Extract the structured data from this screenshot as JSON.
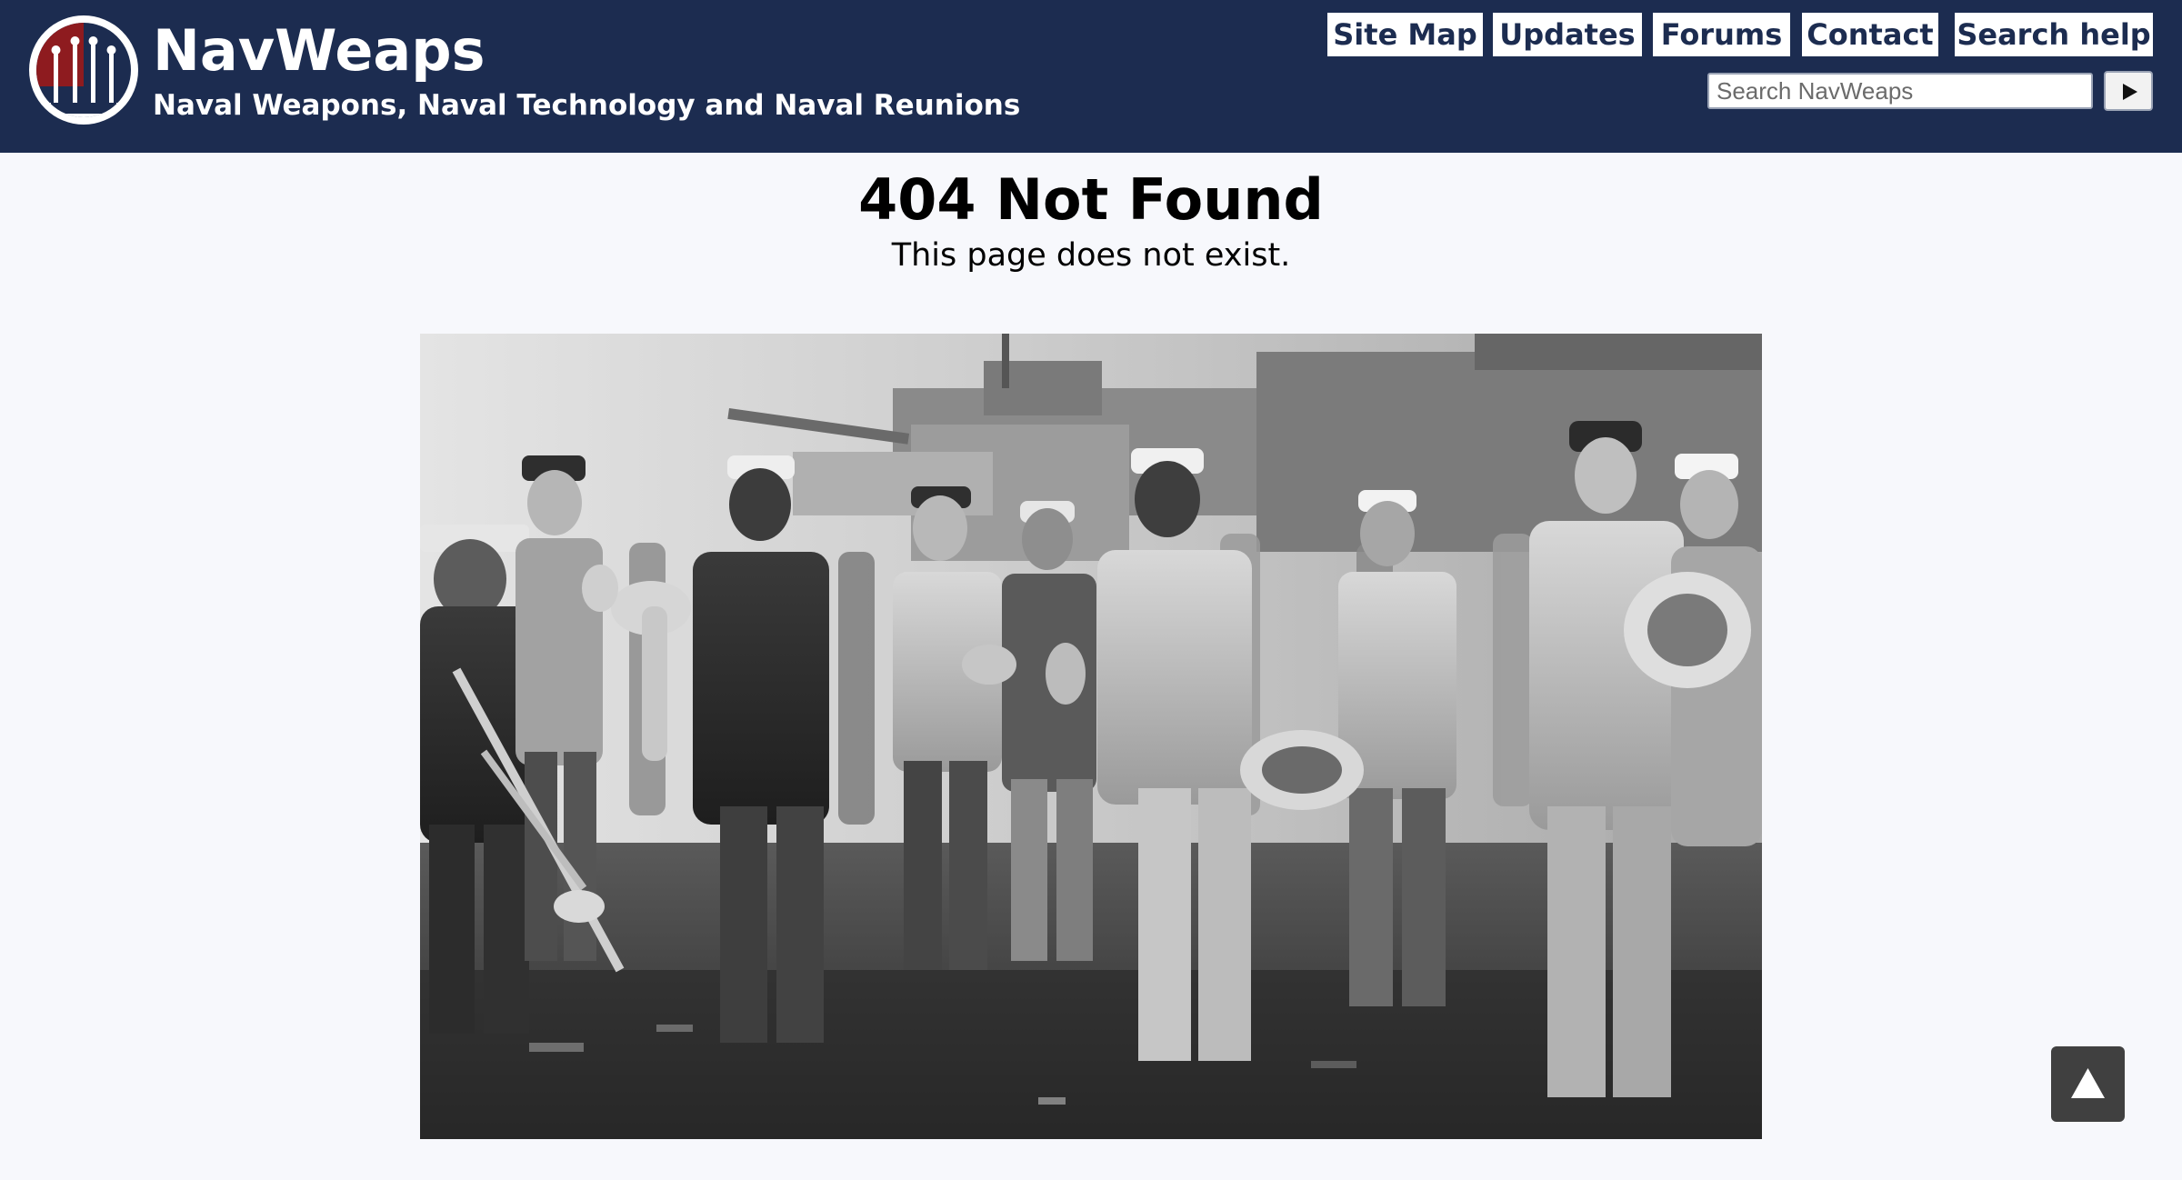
{
  "header": {
    "site_title": "NavWeaps",
    "site_subtitle": "Naval Weapons, Naval Technology and Naval Reunions",
    "background_color": "#1c2c50",
    "nav": {
      "site_map": "Site Map",
      "updates": "Updates",
      "forums": "Forums",
      "contact": "Contact",
      "search_help": "Search help"
    },
    "search": {
      "placeholder": "Search NavWeaps",
      "value": "",
      "submit_icon": "play-triangle-icon"
    }
  },
  "main": {
    "title": "404 Not Found",
    "message": "This page does not exist.",
    "photo_icon": "photo-sailors-band-on-deck"
  },
  "controls": {
    "back_to_top_icon": "up-triangle-icon"
  }
}
